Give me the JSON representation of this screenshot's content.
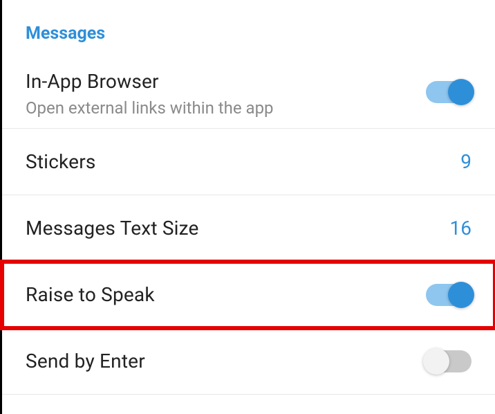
{
  "section": {
    "header": "Messages"
  },
  "rows": {
    "in_app_browser": {
      "title": "In-App Browser",
      "subtitle": "Open external links within the app",
      "toggle": true
    },
    "stickers": {
      "title": "Stickers",
      "value": "9"
    },
    "messages_text_size": {
      "title": "Messages Text Size",
      "value": "16"
    },
    "raise_to_speak": {
      "title": "Raise to Speak",
      "toggle": true
    },
    "send_by_enter": {
      "title": "Send by Enter",
      "toggle": false
    }
  }
}
